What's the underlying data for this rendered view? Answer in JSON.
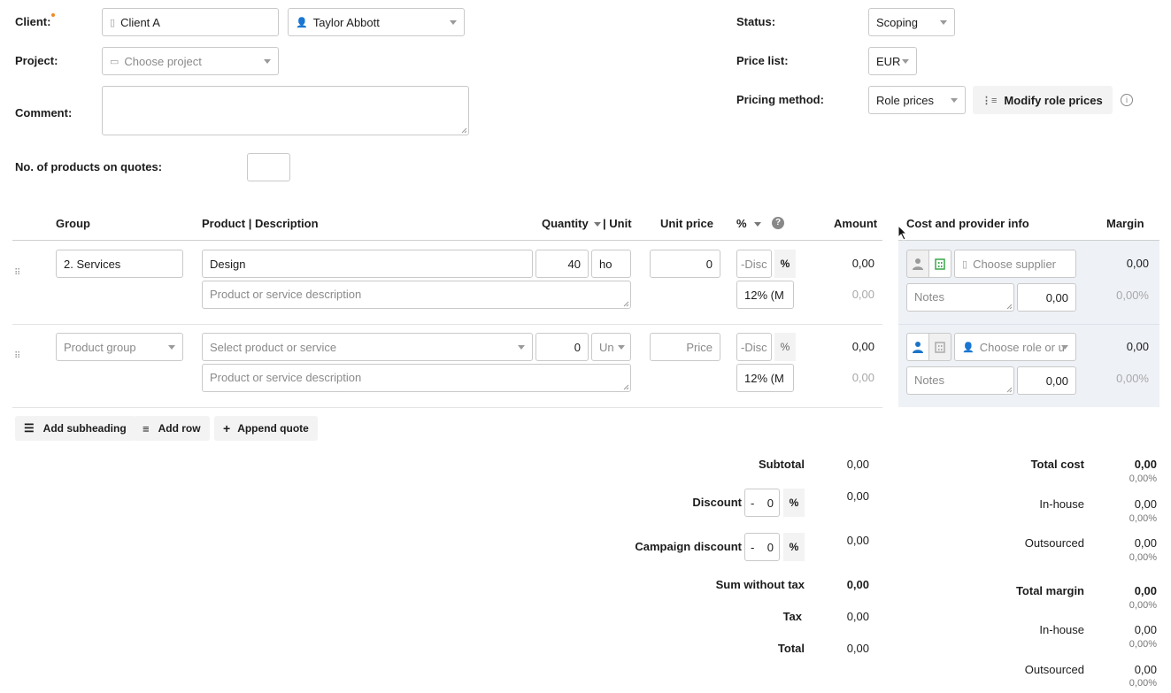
{
  "header": {
    "client_label": "Client:",
    "client_value": "Client A",
    "contact_value": "Taylor Abbott",
    "project_label": "Project:",
    "project_placeholder": "Choose project",
    "comment_label": "Comment:",
    "products_count_label": "No. of products on quotes:",
    "status_label": "Status:",
    "status_value": "Scoping",
    "price_list_label": "Price list:",
    "price_list_value": "EUR",
    "pricing_method_label": "Pricing method:",
    "pricing_method_value": "Role prices",
    "modify_role_prices": "Modify role prices"
  },
  "table": {
    "headers": {
      "group": "Group",
      "product": "Product",
      "description": "Description",
      "quantity": "Quantity",
      "unit": "Unit",
      "unit_price": "Unit price",
      "percent": "%",
      "amount": "Amount",
      "cost_info": "Cost and provider info",
      "margin": "Margin"
    },
    "rows": [
      {
        "group": "2. Services",
        "product": "Design",
        "description_placeholder": "Product or service description",
        "quantity": "40",
        "unit": "ho",
        "unit_price": "0",
        "discount_placeholder": "-Disc",
        "pct_sign": "%",
        "tax": "12% (M",
        "amount": "0,00",
        "amount_sub": "0,00",
        "supplier_placeholder": "Choose supplier",
        "notes_placeholder": "Notes",
        "cost": "0,00",
        "margin": "0,00",
        "margin_pct": "0,00%"
      },
      {
        "group_placeholder": "Product group",
        "product_placeholder": "Select product or service",
        "description_placeholder": "Product or service description",
        "quantity": "0",
        "unit": "Un",
        "price_placeholder": "Price",
        "discount_placeholder": "-Disc",
        "pct_sign": "%",
        "tax": "12% (M",
        "amount": "0,00",
        "amount_sub": "0,00",
        "role_placeholder": "Choose role or u",
        "notes_placeholder": "Notes",
        "cost": "0,00",
        "margin": "0,00",
        "margin_pct": "0,00%"
      }
    ]
  },
  "actions": {
    "add_subheading": "Add subheading",
    "add_row": "Add row",
    "append_quote": "Append quote"
  },
  "totals": {
    "subtotal_label": "Subtotal",
    "subtotal": "0,00",
    "discount_label": "Discount",
    "discount_sign": "-",
    "discount_value": "0",
    "discount_pct": "%",
    "discount_amount": "0,00",
    "campaign_label": "Campaign discount",
    "campaign_sign": "-",
    "campaign_value": "0",
    "campaign_pct": "%",
    "campaign_amount": "0,00",
    "sum_without_tax_label": "Sum without tax",
    "sum_without_tax": "0,00",
    "tax_label": "Tax",
    "tax": "0,00",
    "total_label": "Total",
    "total": "0,00"
  },
  "cost_totals": {
    "total_cost_label": "Total cost",
    "total_cost": "0,00",
    "total_cost_pct": "0,00%",
    "inhouse_label": "In-house",
    "inhouse": "0,00",
    "inhouse_pct": "0,00%",
    "outsourced_label": "Outsourced",
    "outsourced": "0,00",
    "outsourced_pct": "0,00%",
    "total_margin_label": "Total margin",
    "total_margin": "0,00",
    "total_margin_pct": "0,00%",
    "margin_inhouse_label": "In-house",
    "margin_inhouse": "0,00",
    "margin_inhouse_pct": "0,00%",
    "margin_outsourced_label": "Outsourced",
    "margin_outsourced": "0,00",
    "margin_outsourced_pct": "0,00%"
  },
  "colors": {
    "accent_blue": "#1a73c9",
    "accent_green": "#3aa64a",
    "required_dot": "#f08a24",
    "panel_bg": "#eef1f6"
  }
}
